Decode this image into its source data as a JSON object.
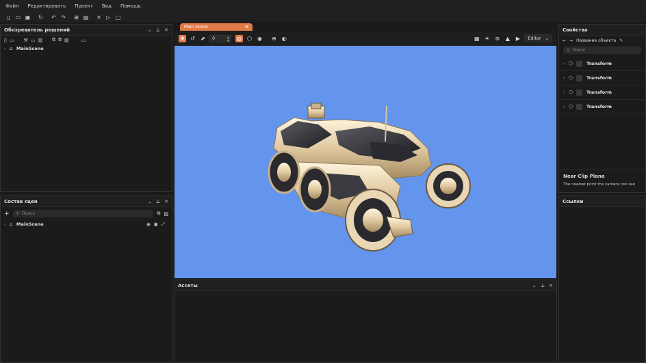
{
  "menu": [
    "Файл",
    "Редактировать",
    "Проект",
    "Вид",
    "Помощь"
  ],
  "toolbar_icons": [
    "new-file-icon",
    "open-folder-icon",
    "save-icon",
    "refresh-icon",
    "undo-icon",
    "redo-icon",
    "code-icon",
    "monitor-icon",
    "tools-icon",
    "play-icon",
    "stop-icon"
  ],
  "solution_explorer": {
    "title": "Обозреватель решений",
    "tree": [
      {
        "label": "MainScene"
      }
    ]
  },
  "scene_composition": {
    "title": "Состав сцен",
    "search_placeholder": "Поиск",
    "tree": [
      {
        "label": "MainScene"
      }
    ]
  },
  "scene_tab": {
    "label": "Main Scene"
  },
  "scene_toolbar": {
    "frame_value": "0",
    "view_mode": "Editor"
  },
  "viewport": {
    "background": "#6495ed"
  },
  "assets": {
    "title": "Ассеты"
  },
  "properties": {
    "title": "Свойства",
    "object_name": "Название объекта",
    "search_placeholder": "Поиск",
    "components": [
      {
        "label": "Transform"
      },
      {
        "label": "Transform"
      },
      {
        "label": "Transform"
      },
      {
        "label": "Transform"
      }
    ],
    "help_title": "Near Clip Plane",
    "help_text": "The nearest point the camera can see"
  },
  "links": {
    "title": "Ссылки"
  },
  "colors": {
    "accent": "#e07a48",
    "viewport": "#6495ed"
  }
}
